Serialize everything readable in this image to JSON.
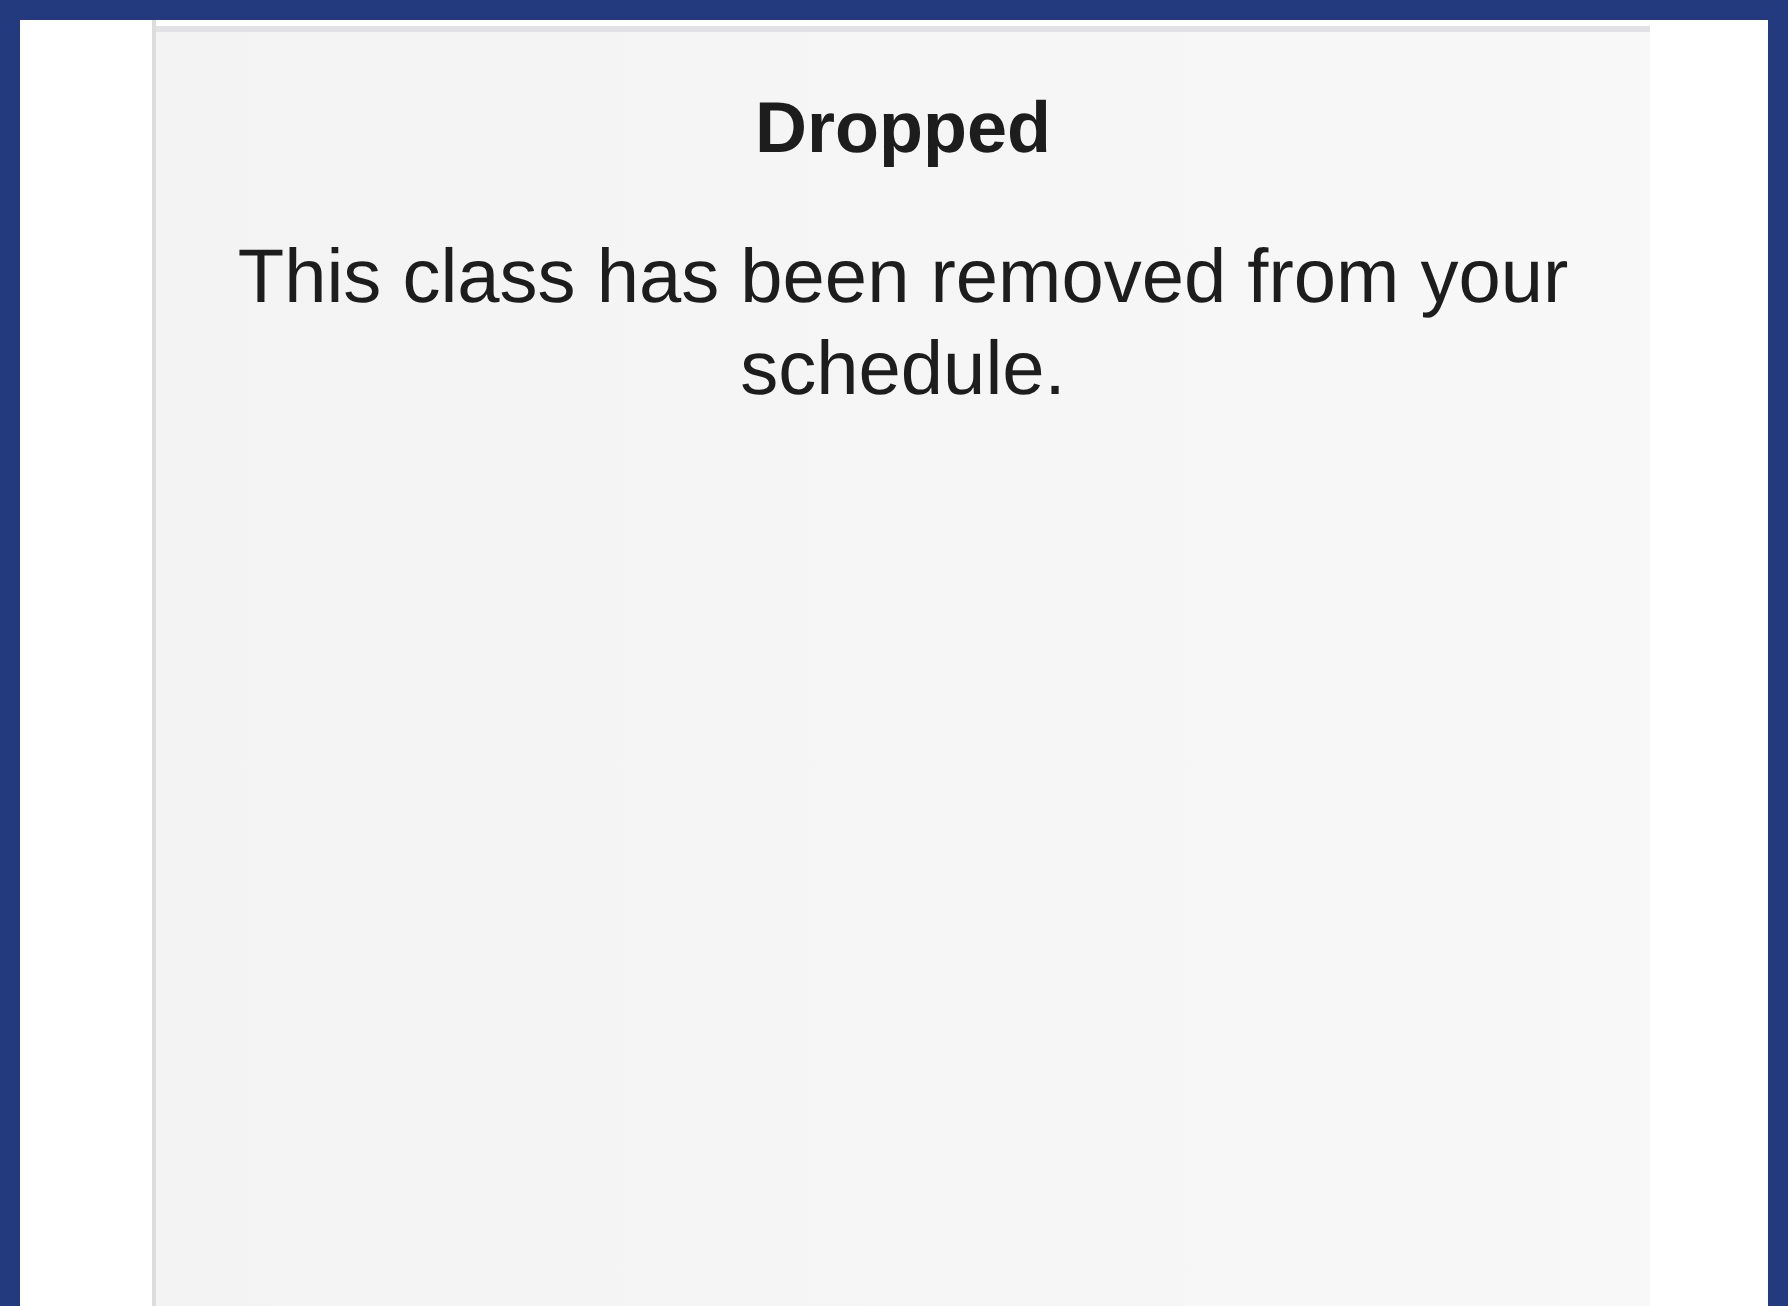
{
  "card": {
    "title": "Dropped",
    "message": "This class has been removed from your schedule."
  }
}
